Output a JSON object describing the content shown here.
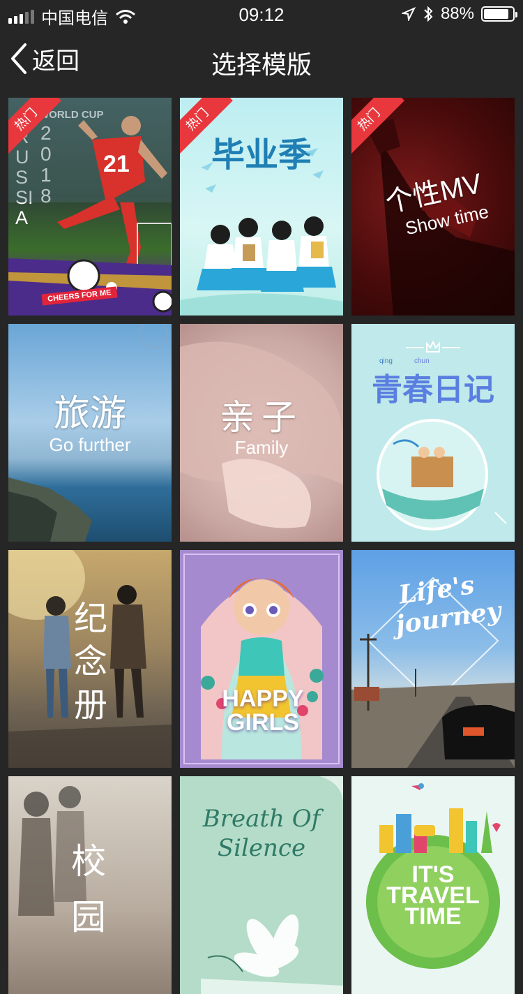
{
  "status_bar": {
    "carrier": "中国电信",
    "time": "09:12",
    "battery_percent_text": "88%",
    "battery_level": 0.88
  },
  "nav": {
    "back_label": "返回",
    "title": "选择模版"
  },
  "hot_badge": "热门",
  "templates": [
    {
      "title_lines": [
        "WORLD CUP",
        "RUSSIA",
        "2018"
      ],
      "badge": "CHEERS FOR ME",
      "hot": true,
      "number": "21"
    },
    {
      "title": "毕业季",
      "hot": true
    },
    {
      "title": "个性MV",
      "subtitle": "Show time",
      "hot": true
    },
    {
      "title": "旅游",
      "subtitle": "Go further",
      "hot": false
    },
    {
      "title": "亲子",
      "subtitle": "Family",
      "hot": false
    },
    {
      "title": "青春日记",
      "pinyin": [
        "qing",
        "chun"
      ],
      "hot": false
    },
    {
      "title": "纪念册",
      "hot": false
    },
    {
      "title": "HAPPY GIRLS",
      "hot": false
    },
    {
      "title": "Life's journey",
      "hot": false
    },
    {
      "title": "校园",
      "hot": false
    },
    {
      "title": "Breath Of Silence",
      "hot": false
    },
    {
      "title": "IT'S TRAVEL TIME",
      "hot": false
    }
  ]
}
